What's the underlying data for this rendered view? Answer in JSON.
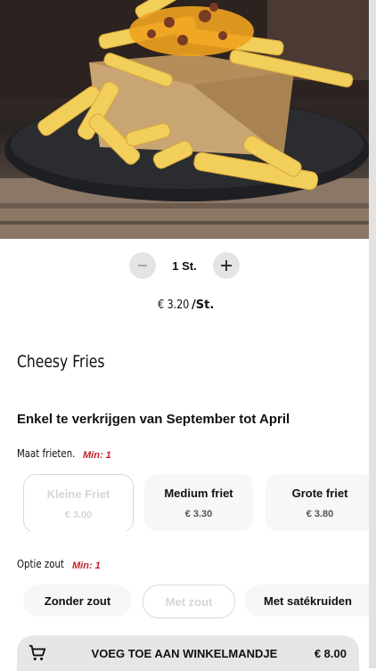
{
  "quantity": {
    "value_label": "1 St."
  },
  "price": {
    "amount": "€ 3.20",
    "unit_suffix": "/St."
  },
  "product": {
    "title": "Cheesy Fries",
    "availability": "Enkel te verkrijgen van September tot April"
  },
  "size_group": {
    "label": "Maat frieten.",
    "min": "Min: 1",
    "options": [
      {
        "name": "Kleine Friet",
        "price": "€ 3.00",
        "state": "disabled"
      },
      {
        "name": "Medium friet",
        "price": "€ 3.30",
        "state": "enabled"
      },
      {
        "name": "Grote friet",
        "price": "€ 3.80",
        "state": "enabled"
      }
    ]
  },
  "salt_group": {
    "label": "Optie zout",
    "min": "Min: 1",
    "options": [
      {
        "name": "Zonder zout",
        "state": "enabled"
      },
      {
        "name": "Met zout",
        "state": "disabled"
      },
      {
        "name": "Met satékruiden",
        "state": "enabled"
      }
    ]
  },
  "cart": {
    "button_label": "VOEG TOE AAN WINKELMANDJE",
    "total": "€ 8.00",
    "icon": "cart-icon"
  },
  "colors": {
    "min_tag": "#c0202a",
    "control_bg": "#e4e4e4",
    "bar_bg": "#e6e6e6"
  }
}
